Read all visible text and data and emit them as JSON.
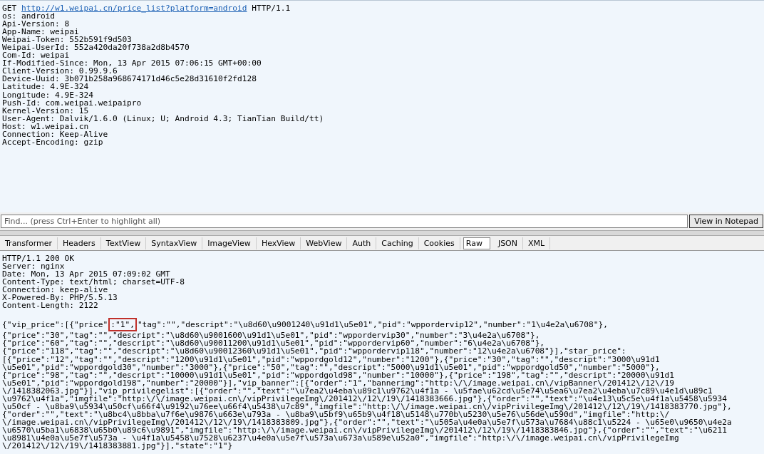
{
  "request": {
    "method": "GET",
    "url": "http://w1.weipai.cn/price_list?platform=android",
    "protocol": "HTTP/1.1",
    "headers": [
      "os: android",
      "Api-Version: 8",
      "App-Name: weipai",
      "Weipai-Token: 552b591f9d503",
      "Weipai-UserId: 552a420da20f738a2d8b4570",
      "Com-Id: weipai",
      "If-Modified-Since: Mon, 13 Apr 2015 07:06:15 GMT+00:00",
      "Client-Version: 0.99.9.6",
      "Device-Uuid: 3b071b258a968674171d46c5e28d31610f2fd128",
      "Latitude: 4.9E-324",
      "Longitude: 4.9E-324",
      "Push-Id: com.weipai.weipaipro",
      "Kernel-Version: 15",
      "User-Agent: Dalvik/1.6.0 (Linux; U; Android 4.3; TianTian Build/tt)",
      "Host: w1.weipai.cn",
      "Connection: Keep-Alive",
      "Accept-Encoding: gzip"
    ]
  },
  "find": {
    "placeholder": "Find... (press Ctrl+Enter to highlight all)",
    "button": "View in Notepad"
  },
  "tabs": [
    {
      "label": "Transformer",
      "selected": false
    },
    {
      "label": "Headers",
      "selected": false
    },
    {
      "label": "TextView",
      "selected": false
    },
    {
      "label": "SyntaxView",
      "selected": false
    },
    {
      "label": "ImageView",
      "selected": false
    },
    {
      "label": "HexView",
      "selected": false
    },
    {
      "label": "WebView",
      "selected": false
    },
    {
      "label": "Auth",
      "selected": false
    },
    {
      "label": "Caching",
      "selected": false
    },
    {
      "label": "Cookies",
      "selected": false
    },
    {
      "label": "Raw",
      "selected": true
    },
    {
      "label": "JSON",
      "selected": false
    },
    {
      "label": "XML",
      "selected": false
    }
  ],
  "response": {
    "headers": [
      "HTTP/1.1 200 OK",
      "Server: nginx",
      "Date: Mon, 13 Apr 2015 07:09:02 GMT",
      "Content-Type: text/html; charset=UTF-8",
      "Connection: keep-alive",
      "X-Powered-By: PHP/5.5.13",
      "Content-Length: 2122"
    ],
    "body_lines": [
      [
        {
          "text": "{\"vip_price\":[{\"price\"",
          "boxed": false
        },
        {
          "text": ":\"1\",",
          "boxed": true
        },
        {
          "text": "\"tag\":\"\",\"descript\":\"\\u8d60\\u9001240\\u91d1\\u5e01\",\"pid\":\"wppordervip12\",\"number\":\"1\\u4e2a\\u6708\"},",
          "boxed": false
        }
      ],
      [
        {
          "text": "{\"price\":\"30\",\"tag\":\"\",\"descript\":\"\\u8d60\\u9001600\\u91d1\\u5e01\",\"pid\":\"wppordervip30\",\"number\":\"3\\u4e2a\\u6708\"},",
          "boxed": false
        }
      ],
      [
        {
          "text": "{\"price\":\"60\",\"tag\":\"\",\"descript\":\"\\u8d60\\u90011200\\u91d1\\u5e01\",\"pid\":\"wppordervip60\",\"number\":\"6\\u4e2a\\u6708\"},",
          "boxed": false
        }
      ],
      [
        {
          "text": "{\"price\":\"118\",\"tag\":\"\",\"descript\":\"\\u8d60\\u90012360\\u91d1\\u5e01\",\"pid\":\"wppordervip118\",\"number\":\"12\\u4e2a\\u6708\"}],\"star_price\":",
          "boxed": false
        }
      ],
      [
        {
          "text": "[{\"price\":\"12\",\"tag\":\"\",\"descript\":\"1200\\u91d1\\u5e01\",\"pid\":\"wppordgold12\",\"number\":\"1200\"},{\"price\":\"30\",\"tag\":\"\",\"descript\":\"3000\\u91d1",
          "boxed": false
        }
      ],
      [
        {
          "text": "\\u5e01\",\"pid\":\"wppordgold30\",\"number\":\"3000\"},{\"price\":\"50\",\"tag\":\"\",\"descript\":\"5000\\u91d1\\u5e01\",\"pid\":\"wppordgold50\",\"number\":\"5000\"},",
          "boxed": false
        }
      ],
      [
        {
          "text": "{\"price\":\"98\",\"tag\":\"\",\"descript\":\"10000\\u91d1\\u5e01\",\"pid\":\"wppordgold98\",\"number\":\"10000\"},{\"price\":\"198\",\"tag\":\"\",\"descript\":\"20000\\u91d1",
          "boxed": false
        }
      ],
      [
        {
          "text": "\\u5e01\",\"pid\":\"wppordgold198\",\"number\":\"20000\"}],\"vip_banner\":[{\"order\":\"1\",\"bannerimg\":\"http:\\/\\/image.weipai.cn\\/vipBanner\\/201412\\/12\\/19",
          "boxed": false
        }
      ],
      [
        {
          "text": "\\/1418382063.jpg\"}],\"vip_privilegelist\":[{\"order\":\"\",\"text\":\"\\u7ea2\\u4eba\\u89c1\\u9762\\u4f1a - \\u5fae\\u62cd\\u5e74\\u5ea6\\u7ea2\\u4eba\\u7c89\\u4e1d\\u89c1",
          "boxed": false
        }
      ],
      [
        {
          "text": "\\u9762\\u4f1a\",\"imgfile\":\"http:\\/\\/image.weipai.cn\\/vipPrivilegeImg\\/201412\\/12\\/19\\/1418383666.jpg\"},{\"order\":\"\",\"text\":\"\\u4e13\\u5c5e\\u4f1a\\u5458\\u5934",
          "boxed": false
        }
      ],
      [
        {
          "text": "\\u50cf - \\u8ba9\\u5934\\u50cf\\u66f4\\u9192\\u76ee\\u66f4\\u5438\\u7c89\",\"imgfile\":\"http:\\/\\/image.weipai.cn\\/vipPrivilegeImg\\/201412\\/12\\/19\\/1418383770.jpg\"},",
          "boxed": false
        }
      ],
      [
        {
          "text": "{\"order\":\"\",\"text\":\"\\u8bc4\\u8bba\\u7f6e\\u9876\\u663e\\u793a - \\u8ba9\\u5bf9\\u65b9\\u4f18\\u5148\\u770b\\u5230\\u5e76\\u56de\\u590d\",\"imgfile\":\"http:\\/",
          "boxed": false
        }
      ],
      [
        {
          "text": "\\/image.weipai.cn\\/vipPrivilegeImg\\/201412\\/12\\/19\\/1418383809.jpg\"},{\"order\":\"\",\"text\":\"\\u505a\\u4e0a\\u5e7f\\u573a\\u7684\\u88c1\\u5224 - \\u65e0\\u9650\\u4e2a",
          "boxed": false
        }
      ],
      [
        {
          "text": "\\u6570\\u5ba1\\u6838\\u65b0\\u89c6\\u9891\",\"imgfile\":\"http:\\/\\/image.weipai.cn\\/vipPrivilegeImg\\/201412\\/12\\/19\\/1418383846.jpg\"},{\"order\":\"\",\"text\":\"\\u6211",
          "boxed": false
        }
      ],
      [
        {
          "text": "\\u8981\\u4e0a\\u5e7f\\u573a - \\u4f1a\\u5458\\u7528\\u6237\\u4e0a\\u5e7f\\u573a\\u673a\\u589e\\u52a0\",\"imgfile\":\"http:\\/\\/image.weipai.cn\\/vipPrivilegeImg",
          "boxed": false
        }
      ],
      [
        {
          "text": "\\/201412\\/12\\/19\\/1418383881.jpg\"}],\"state\":\"1\"}",
          "boxed": false
        }
      ]
    ]
  }
}
